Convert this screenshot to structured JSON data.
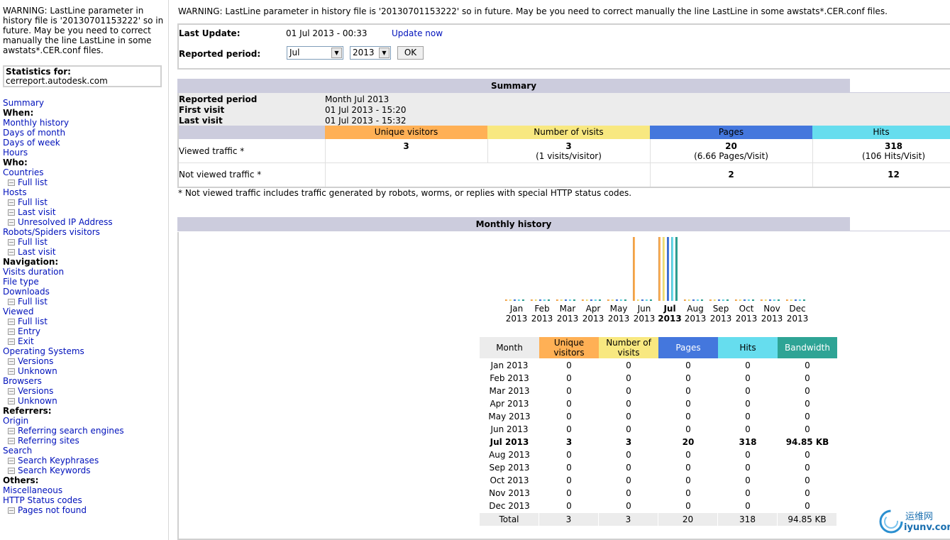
{
  "left": {
    "warning": "WARNING: LastLine parameter in history file is '20130701153222' so in future. May be you need to correct manually the line LastLine in some awstats*.CER.conf files.",
    "stats_label": "Statistics for:",
    "stats_site": "cerreport.autodesk.com",
    "menu": [
      {
        "t": "link",
        "label": "Summary"
      },
      {
        "t": "hdr",
        "label": "When:"
      },
      {
        "t": "link",
        "label": "Monthly history"
      },
      {
        "t": "link",
        "label": "Days of month"
      },
      {
        "t": "link",
        "label": "Days of week"
      },
      {
        "t": "link",
        "label": "Hours"
      },
      {
        "t": "hdr",
        "label": "Who:"
      },
      {
        "t": "link",
        "label": "Countries"
      },
      {
        "t": "sub",
        "label": "Full list"
      },
      {
        "t": "link",
        "label": "Hosts"
      },
      {
        "t": "sub",
        "label": "Full list"
      },
      {
        "t": "sub",
        "label": "Last visit"
      },
      {
        "t": "sub",
        "label": "Unresolved IP Address"
      },
      {
        "t": "link",
        "label": "Robots/Spiders visitors"
      },
      {
        "t": "sub",
        "label": "Full list"
      },
      {
        "t": "sub",
        "label": "Last visit"
      },
      {
        "t": "hdr",
        "label": "Navigation:"
      },
      {
        "t": "link",
        "label": "Visits duration"
      },
      {
        "t": "link",
        "label": "File type"
      },
      {
        "t": "link",
        "label": "Downloads"
      },
      {
        "t": "sub",
        "label": "Full list"
      },
      {
        "t": "link",
        "label": "Viewed"
      },
      {
        "t": "sub",
        "label": "Full list"
      },
      {
        "t": "sub",
        "label": "Entry"
      },
      {
        "t": "sub",
        "label": "Exit"
      },
      {
        "t": "link",
        "label": "Operating Systems"
      },
      {
        "t": "sub",
        "label": "Versions"
      },
      {
        "t": "sub",
        "label": "Unknown"
      },
      {
        "t": "link",
        "label": "Browsers"
      },
      {
        "t": "sub",
        "label": "Versions"
      },
      {
        "t": "sub",
        "label": "Unknown"
      },
      {
        "t": "hdr",
        "label": "Referrers:"
      },
      {
        "t": "link",
        "label": "Origin"
      },
      {
        "t": "sub",
        "label": "Referring search engines"
      },
      {
        "t": "sub",
        "label": "Referring sites"
      },
      {
        "t": "link",
        "label": "Search"
      },
      {
        "t": "sub",
        "label": "Search Keyphrases"
      },
      {
        "t": "sub",
        "label": "Search Keywords"
      },
      {
        "t": "hdr",
        "label": "Others:"
      },
      {
        "t": "link",
        "label": "Miscellaneous"
      },
      {
        "t": "link",
        "label": "HTTP Status codes"
      },
      {
        "t": "sub",
        "label": "Pages not found"
      }
    ]
  },
  "top_warning": "WARNING: LastLine parameter in history file is '20130701153222' so in future. May be you need to correct manually the line LastLine in some awstats*.CER.conf files.",
  "update": {
    "last_update_label": "Last Update:",
    "last_update_value": "01 Jul 2013 - 00:33",
    "update_now": "Update now",
    "period_label": "Reported period:",
    "month": "Jul",
    "year": "2013",
    "ok": "OK"
  },
  "summary": {
    "title": "Summary",
    "reported_period_label": "Reported period",
    "reported_period_value": "Month Jul 2013",
    "first_visit_label": "First visit",
    "first_visit_value": "01 Jul 2013 - 15:20",
    "last_visit_label": "Last visit",
    "last_visit_value": "01 Jul 2013 - 15:32",
    "col_unique": "Unique visitors",
    "col_visits": "Number of visits",
    "col_pages": "Pages",
    "col_hits": "Hits",
    "viewed_label": "Viewed traffic *",
    "viewed_unique": "3",
    "viewed_visits": "3",
    "viewed_visits_sub": "(1 visits/visitor)",
    "viewed_pages": "20",
    "viewed_pages_sub": "(6.66 Pages/Visit)",
    "viewed_hits": "318",
    "viewed_hits_sub": "(106 Hits/Visit)",
    "notviewed_label": "Not viewed traffic *",
    "notviewed_pages": "2",
    "notviewed_hits": "12",
    "footnote": "* Not viewed traffic includes traffic generated by robots, worms, or replies with special HTTP status codes."
  },
  "history": {
    "title": "Monthly history",
    "col_month": "Month",
    "col_unique": "Unique visitors",
    "col_visits": "Number of visits",
    "col_pages": "Pages",
    "col_hits": "Hits",
    "col_bandwidth": "Bandwidth",
    "rows": [
      {
        "month": "Jan 2013",
        "u": "0",
        "v": "0",
        "p": "0",
        "h": "0",
        "bw": "0"
      },
      {
        "month": "Feb 2013",
        "u": "0",
        "v": "0",
        "p": "0",
        "h": "0",
        "bw": "0"
      },
      {
        "month": "Mar 2013",
        "u": "0",
        "v": "0",
        "p": "0",
        "h": "0",
        "bw": "0"
      },
      {
        "month": "Apr 2013",
        "u": "0",
        "v": "0",
        "p": "0",
        "h": "0",
        "bw": "0"
      },
      {
        "month": "May 2013",
        "u": "0",
        "v": "0",
        "p": "0",
        "h": "0",
        "bw": "0"
      },
      {
        "month": "Jun 2013",
        "u": "0",
        "v": "0",
        "p": "0",
        "h": "0",
        "bw": "0"
      },
      {
        "month": "Jul 2013",
        "u": "3",
        "v": "3",
        "p": "20",
        "h": "318",
        "bw": "94.85 KB",
        "current": true
      },
      {
        "month": "Aug 2013",
        "u": "0",
        "v": "0",
        "p": "0",
        "h": "0",
        "bw": "0"
      },
      {
        "month": "Sep 2013",
        "u": "0",
        "v": "0",
        "p": "0",
        "h": "0",
        "bw": "0"
      },
      {
        "month": "Oct 2013",
        "u": "0",
        "v": "0",
        "p": "0",
        "h": "0",
        "bw": "0"
      },
      {
        "month": "Nov 2013",
        "u": "0",
        "v": "0",
        "p": "0",
        "h": "0",
        "bw": "0"
      },
      {
        "month": "Dec 2013",
        "u": "0",
        "v": "0",
        "p": "0",
        "h": "0",
        "bw": "0"
      }
    ],
    "total_label": "Total",
    "total": {
      "u": "3",
      "v": "3",
      "p": "20",
      "h": "318",
      "bw": "94.85 KB"
    },
    "chart_months": [
      {
        "m": "Jan",
        "y": "2013"
      },
      {
        "m": "Feb",
        "y": "2013"
      },
      {
        "m": "Mar",
        "y": "2013"
      },
      {
        "m": "Apr",
        "y": "2013"
      },
      {
        "m": "May",
        "y": "2013"
      },
      {
        "m": "Jun",
        "y": "2013"
      },
      {
        "m": "Jul",
        "y": "2013",
        "current": true
      },
      {
        "m": "Aug",
        "y": "2013"
      },
      {
        "m": "Sep",
        "y": "2013"
      },
      {
        "m": "Oct",
        "y": "2013"
      },
      {
        "m": "Nov",
        "y": "2013"
      },
      {
        "m": "Dec",
        "y": "2013"
      }
    ]
  },
  "watermark": {
    "cn": "运维网",
    "url": "iyunv.com"
  },
  "colors": {
    "unique": "#ffb055",
    "visits": "#f8e880",
    "pages": "#4477dd",
    "hits": "#66ddee",
    "bandwidth": "#2ea495",
    "section": "#ccccdd"
  },
  "chart_data": {
    "type": "bar",
    "categories": [
      "Jan 2013",
      "Feb 2013",
      "Mar 2013",
      "Apr 2013",
      "May 2013",
      "Jun 2013",
      "Jul 2013",
      "Aug 2013",
      "Sep 2013",
      "Oct 2013",
      "Nov 2013",
      "Dec 2013"
    ],
    "series": [
      {
        "name": "Unique visitors",
        "values": [
          0,
          0,
          0,
          0,
          0,
          3,
          3,
          0,
          0,
          0,
          0,
          0
        ]
      },
      {
        "name": "Number of visits",
        "values": [
          0,
          0,
          0,
          0,
          0,
          0,
          3,
          0,
          0,
          0,
          0,
          0
        ]
      },
      {
        "name": "Pages",
        "values": [
          0,
          0,
          0,
          0,
          0,
          0,
          20,
          0,
          0,
          0,
          0,
          0
        ]
      },
      {
        "name": "Hits",
        "values": [
          0,
          0,
          0,
          0,
          0,
          0,
          318,
          0,
          0,
          0,
          0,
          0
        ]
      },
      {
        "name": "Bandwidth",
        "values": [
          0,
          0,
          0,
          0,
          0,
          0,
          94.85,
          0,
          0,
          0,
          0,
          0
        ]
      }
    ]
  }
}
